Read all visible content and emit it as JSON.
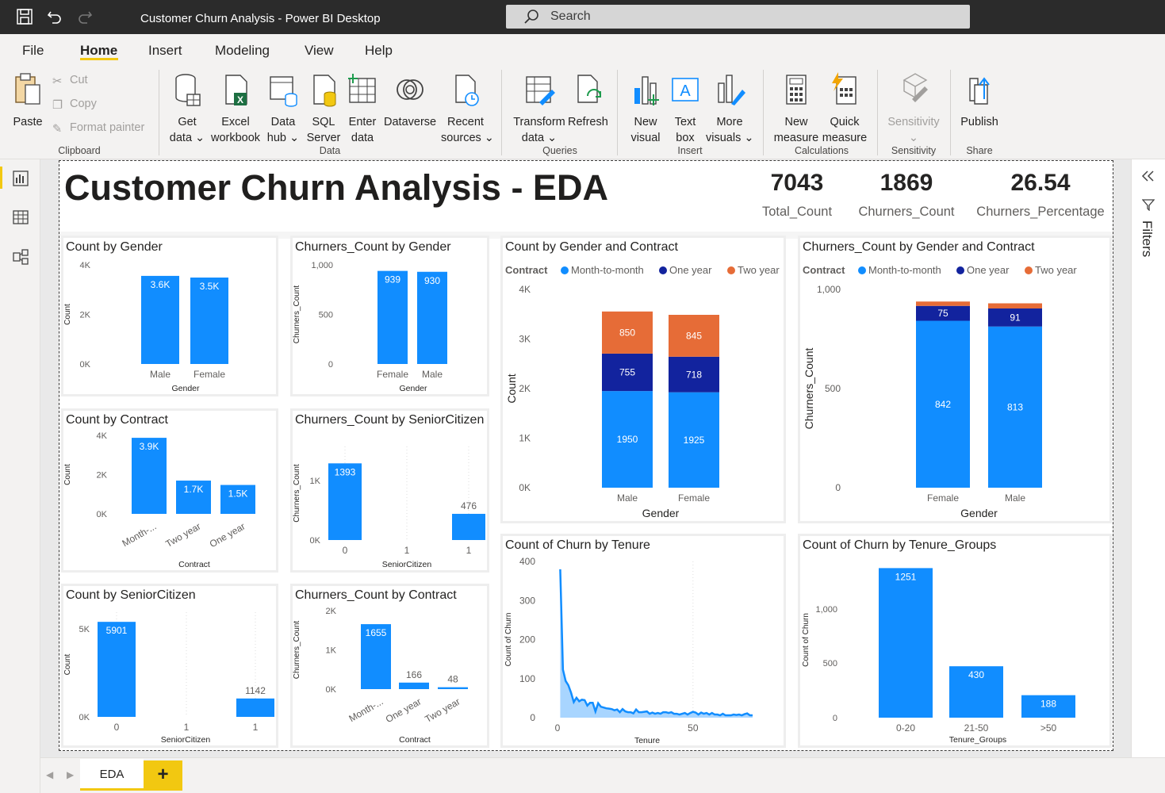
{
  "window": {
    "title": "Customer Churn Analysis - Power BI Desktop",
    "search_placeholder": "Search"
  },
  "menu": [
    "File",
    "Home",
    "Insert",
    "Modeling",
    "View",
    "Help"
  ],
  "ribbon": {
    "paste": "Paste",
    "cut": "Cut",
    "copy": "Copy",
    "format_painter": "Format painter",
    "get_data": [
      "Get",
      "data"
    ],
    "excel": [
      "Excel",
      "workbook"
    ],
    "data_hub": [
      "Data",
      "hub"
    ],
    "sql": [
      "SQL",
      "Server"
    ],
    "enter_data": [
      "Enter",
      "data"
    ],
    "dataverse": "Dataverse",
    "recent": [
      "Recent",
      "sources"
    ],
    "transform": [
      "Transform",
      "data"
    ],
    "refresh": "Refresh",
    "new_visual": [
      "New",
      "visual"
    ],
    "text_box": [
      "Text",
      "box"
    ],
    "more_visuals": [
      "More",
      "visuals"
    ],
    "new_measure": [
      "New",
      "measure"
    ],
    "quick_measure": [
      "Quick",
      "measure"
    ],
    "sensitivity": "Sensitivity",
    "publish": "Publish",
    "groups": {
      "clipboard": "Clipboard",
      "data": "Data",
      "queries": "Queries",
      "insert": "Insert",
      "calculations": "Calculations",
      "sensitivity": "Sensitivity",
      "share": "Share"
    }
  },
  "report": {
    "title": "Customer Churn Analysis - EDA",
    "kpis": [
      {
        "value": "7043",
        "label": "Total_Count"
      },
      {
        "value": "1869",
        "label": "Churners_Count"
      },
      {
        "value": "26.54",
        "label": "Churners_Percentage"
      }
    ]
  },
  "filters_label": "Filters",
  "pages": {
    "active": "EDA",
    "add": "+"
  },
  "colors": {
    "blue": "#118dff",
    "navy": "#12239e",
    "orange": "#e66c37",
    "accent": "#f2c811"
  },
  "chart_data": [
    {
      "id": "count-by-gender",
      "type": "bar",
      "title": "Count by Gender",
      "xlabel": "Gender",
      "ylabel": "Count",
      "categories": [
        "Male",
        "Female"
      ],
      "values": [
        3555,
        3488
      ],
      "value_labels": [
        "3.6K",
        "3.5K"
      ],
      "yticks": [
        "4K",
        "2K",
        "0K"
      ],
      "ylim": [
        0,
        4000
      ]
    },
    {
      "id": "churners-by-gender",
      "type": "bar",
      "title": "Churners_Count by Gender",
      "xlabel": "Gender",
      "ylabel": "Churners_Count",
      "categories": [
        "Female",
        "Male"
      ],
      "values": [
        939,
        930
      ],
      "value_labels": [
        "939",
        "930"
      ],
      "yticks": [
        "1,000",
        "500",
        "0"
      ],
      "ylim": [
        0,
        1000
      ]
    },
    {
      "id": "count-by-contract",
      "type": "bar",
      "title": "Count by Contract",
      "xlabel": "Contract",
      "ylabel": "Count",
      "categories": [
        "Month-...",
        "Two year",
        "One year"
      ],
      "values": [
        3875,
        1695,
        1473
      ],
      "value_labels": [
        "3.9K",
        "1.7K",
        "1.5K"
      ],
      "yticks": [
        "4K",
        "2K",
        "0K"
      ],
      "ylim": [
        0,
        4000
      ]
    },
    {
      "id": "churners-by-senior",
      "type": "bar",
      "title": "Churners_Count by SeniorCitizen",
      "xlabel": "SeniorCitizen",
      "ylabel": "Churners_Count",
      "categories": [
        "0",
        "1"
      ],
      "x_ticks": [
        "0",
        "1",
        "1"
      ],
      "values": [
        1393,
        476
      ],
      "value_labels": [
        "1393",
        "476"
      ],
      "yticks": [
        "1K",
        "0K"
      ],
      "ylim": [
        0,
        1700
      ]
    },
    {
      "id": "count-by-senior",
      "type": "bar",
      "title": "Count by SeniorCitizen",
      "xlabel": "SeniorCitizen",
      "ylabel": "Count",
      "categories": [
        "0",
        "1"
      ],
      "x_ticks": [
        "0",
        "1",
        "1"
      ],
      "values": [
        5901,
        1142
      ],
      "value_labels": [
        "5901",
        "1142"
      ],
      "yticks": [
        "5K",
        "0K"
      ],
      "ylim": [
        0,
        6500
      ]
    },
    {
      "id": "churners-by-contract",
      "type": "bar",
      "title": "Churners_Count by Contract",
      "xlabel": "Contract",
      "ylabel": "Churners_Count",
      "categories": [
        "Month-...",
        "One year",
        "Two year"
      ],
      "values": [
        1655,
        166,
        48
      ],
      "value_labels": [
        "1655",
        "166",
        "48"
      ],
      "yticks": [
        "2K",
        "1K",
        "0K"
      ],
      "ylim": [
        0,
        2000
      ]
    },
    {
      "id": "count-by-gender-contract",
      "type": "bar",
      "stacked": true,
      "title": "Count by Gender and Contract",
      "xlabel": "Gender",
      "ylabel": "Count",
      "legend_title": "Contract",
      "categories": [
        "Male",
        "Female"
      ],
      "series": [
        {
          "name": "Month-to-month",
          "values": [
            1950,
            1925
          ]
        },
        {
          "name": "One year",
          "values": [
            755,
            718
          ]
        },
        {
          "name": "Two year",
          "values": [
            850,
            845
          ]
        }
      ],
      "yticks": [
        "4K",
        "3K",
        "2K",
        "1K",
        "0K"
      ],
      "ylim": [
        0,
        4000
      ]
    },
    {
      "id": "churners-by-gender-contract",
      "type": "bar",
      "stacked": true,
      "title": "Churners_Count by Gender and Contract",
      "xlabel": "Gender",
      "ylabel": "Churners_Count",
      "legend_title": "Contract",
      "categories": [
        "Female",
        "Male"
      ],
      "series": [
        {
          "name": "Month-to-month",
          "values": [
            842,
            813
          ]
        },
        {
          "name": "One year",
          "values": [
            75,
            91
          ]
        },
        {
          "name": "Two year",
          "values": [
            22,
            26
          ]
        }
      ],
      "value_labels": [
        [
          "842",
          "813"
        ],
        [
          "75",
          "91"
        ],
        [
          "",
          ""
        ]
      ],
      "yticks": [
        "1,000",
        "500",
        "0"
      ],
      "ylim": [
        0,
        1000
      ]
    },
    {
      "id": "churn-by-tenure",
      "type": "area",
      "title": "Count of Churn by Tenure",
      "xlabel": "Tenure",
      "ylabel": "Count of Churn",
      "xticks": [
        "0",
        "50"
      ],
      "yticks": [
        "400",
        "300",
        "200",
        "100",
        "0"
      ],
      "ylim": [
        0,
        400
      ],
      "xlim": [
        0,
        72
      ],
      "x": [
        1,
        2,
        3,
        4,
        5,
        6,
        7,
        8,
        9,
        10,
        11,
        12,
        13,
        14,
        15,
        16,
        17,
        18,
        19,
        20,
        21,
        22,
        23,
        24,
        25,
        26,
        27,
        28,
        29,
        30,
        31,
        32,
        33,
        34,
        35,
        36,
        37,
        38,
        39,
        40,
        41,
        42,
        43,
        44,
        45,
        46,
        47,
        48,
        49,
        50,
        51,
        52,
        53,
        54,
        55,
        56,
        57,
        58,
        59,
        60,
        61,
        62,
        63,
        64,
        65,
        66,
        67,
        68,
        69,
        70,
        71,
        72
      ],
      "values": [
        380,
        123,
        94,
        83,
        64,
        40,
        51,
        42,
        46,
        45,
        31,
        38,
        38,
        16,
        37,
        28,
        26,
        24,
        23,
        22,
        19,
        21,
        14,
        22,
        16,
        14,
        14,
        11,
        21,
        14,
        14,
        15,
        16,
        10,
        13,
        10,
        12,
        10,
        14,
        14,
        12,
        14,
        10,
        10,
        8,
        10,
        12,
        8,
        12,
        15,
        13,
        8,
        13,
        10,
        12,
        8,
        12,
        8,
        8,
        6,
        10,
        6,
        6,
        6,
        8,
        7,
        8,
        6,
        9,
        11,
        6,
        6
      ]
    },
    {
      "id": "churn-by-tenure-groups",
      "type": "bar",
      "title": "Count of Churn by Tenure_Groups",
      "xlabel": "Tenure_Groups",
      "ylabel": "Count of Churn",
      "categories": [
        "0-20",
        "21-50",
        ">50"
      ],
      "values": [
        1251,
        430,
        188
      ],
      "value_labels": [
        "1251",
        "430",
        "188"
      ],
      "yticks": [
        "1,000",
        "500",
        "0"
      ],
      "ylim": [
        0,
        1300
      ]
    }
  ]
}
